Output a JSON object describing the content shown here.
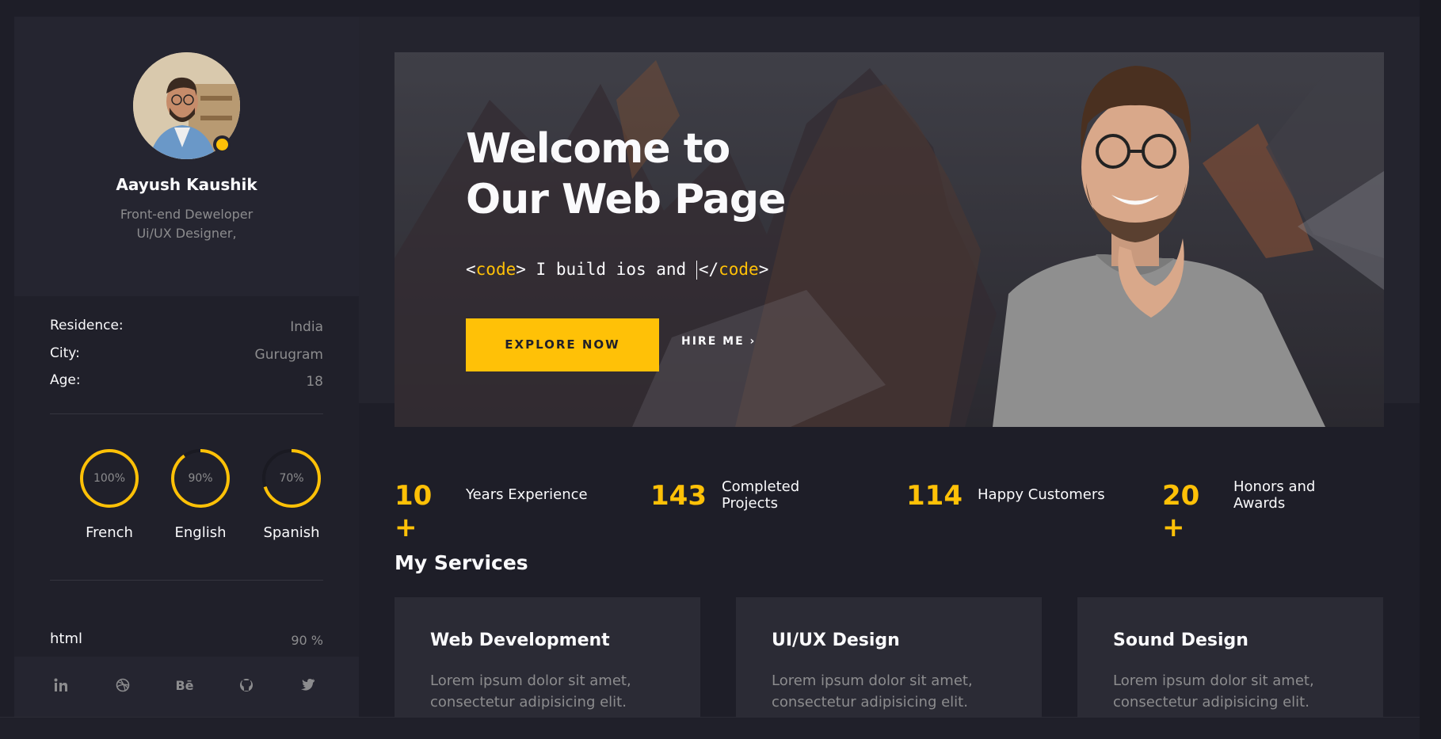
{
  "profile": {
    "name": "Aayush Kaushik",
    "role_line1": "Front-end Deweloper",
    "role_line2": "Ui/UX Designer,"
  },
  "info": [
    {
      "key": "Residence:",
      "value": "India"
    },
    {
      "key": "City:",
      "value": "Gurugram"
    },
    {
      "key": "Age:",
      "value": "18"
    }
  ],
  "languages": [
    {
      "name": "French",
      "percent_label": "100%",
      "percent": 100
    },
    {
      "name": "English",
      "percent_label": "90%",
      "percent": 90
    },
    {
      "name": "Spanish",
      "percent_label": "70%",
      "percent": 70
    }
  ],
  "skill": {
    "name": "html",
    "value_label": "90 %",
    "percent": 90
  },
  "socials": [
    "linkedin-icon",
    "dribbble-icon",
    "behance-icon",
    "github-icon",
    "twitter-icon"
  ],
  "socials_behance_text": "Bē",
  "hero": {
    "title_line1": "Welcome to",
    "title_line2": "Our Web Page",
    "code_open_lt": "<",
    "code_open_tag": "code",
    "code_open_gt": ">",
    "code_text": " I build ios and ",
    "code_close_lt": "</",
    "code_close_tag": "code",
    "code_close_gt": ">",
    "explore_label": "EXPLORE NOW",
    "hire_label": "HIRE ME",
    "hire_chevron": "›"
  },
  "stats": [
    {
      "number": "10 +",
      "label": "Years Experience"
    },
    {
      "number": "143",
      "label": "Completed Projects"
    },
    {
      "number": "114",
      "label": "Happy Customers"
    },
    {
      "number": "20 +",
      "label": "Honors and Awards"
    }
  ],
  "services": {
    "title": "My Services",
    "cards": [
      {
        "title": "Web Development",
        "desc": "Lorem ipsum dolor sit amet, consectetur adipisicing elit."
      },
      {
        "title": "UI/UX Design",
        "desc": "Lorem ipsum dolor sit amet, consectetur adipisicing elit."
      },
      {
        "title": "Sound Design",
        "desc": "Lorem ipsum dolor sit amet, consectetur adipisicing elit."
      }
    ]
  },
  "colors": {
    "accent": "#ffc107",
    "background": "#1e1e28",
    "panel": "#20202a",
    "card": "#2b2b35",
    "muted_text": "#8c8c8e"
  }
}
